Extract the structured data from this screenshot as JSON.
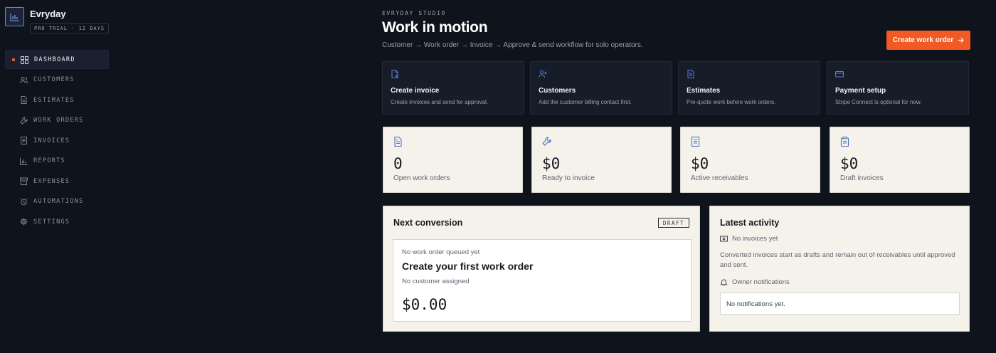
{
  "brand": {
    "name": "Evryday",
    "badge": "PRO TRIAL · 12 DAYS",
    "logo_icon": "bar-chart-icon"
  },
  "sidebar": {
    "items": [
      {
        "label": "DASHBOARD",
        "icon": "grid-icon",
        "active": true
      },
      {
        "label": "CUSTOMERS",
        "icon": "users-icon"
      },
      {
        "label": "ESTIMATES",
        "icon": "file-icon"
      },
      {
        "label": "WORK ORDERS",
        "icon": "wrench-icon"
      },
      {
        "label": "INVOICES",
        "icon": "invoice-icon"
      },
      {
        "label": "REPORTS",
        "icon": "bar-chart-icon"
      },
      {
        "label": "EXPENSES",
        "icon": "archive-icon"
      },
      {
        "label": "AUTOMATIONS",
        "icon": "alarm-icon"
      },
      {
        "label": "SETTINGS",
        "icon": "gear-icon"
      }
    ]
  },
  "header": {
    "eyebrow": "EVRYDAY STUDIO",
    "title": "Work in motion",
    "subtitle": "Customer → Work order → Invoice → Approve & send workflow for solo operators.",
    "cta_label": "Create work order",
    "cta_icon": "arrow-right-icon"
  },
  "quick_actions": [
    {
      "title": "Create invoice",
      "desc": "Create invoices and send for approval.",
      "icon": "file-plus-icon"
    },
    {
      "title": "Customers",
      "desc": "Add the customer billing contact first.",
      "icon": "user-plus-icon"
    },
    {
      "title": "Estimates",
      "desc": "Pre-quote work before work orders.",
      "icon": "file-text-icon"
    },
    {
      "title": "Payment setup",
      "desc": "Stripe Connect is optional for now.",
      "icon": "credit-card-icon"
    }
  ],
  "stats": [
    {
      "value": "0",
      "label": "Open work orders",
      "icon": "file-text-icon"
    },
    {
      "value": "$0",
      "label": "Ready to invoice",
      "icon": "wrench-icon"
    },
    {
      "value": "$0",
      "label": "Active receivables",
      "icon": "receipt-icon"
    },
    {
      "value": "$0",
      "label": "Draft invoices",
      "icon": "clipboard-icon"
    }
  ],
  "next_conversion": {
    "title": "Next conversion",
    "badge": "DRAFT",
    "queue_status": "No work order queued yet",
    "heading": "Create your first work order",
    "customer": "No customer assigned",
    "amount": "$0.00"
  },
  "activity": {
    "title": "Latest activity",
    "invoices_status": "No invoices yet",
    "description": "Converted invoices start as drafts and remain out of receivables until approved and sent.",
    "notifications_label": "Owner notifications",
    "notifications_empty": "No notifications yet."
  },
  "colors": {
    "accent": "#f15a24",
    "background": "#0f131c",
    "card_dark": "#161c28",
    "card_light": "#f4f2ea",
    "icon_blue": "#5b7fd1"
  }
}
